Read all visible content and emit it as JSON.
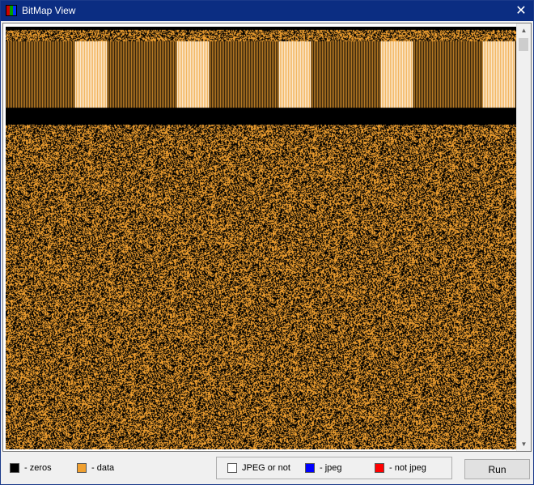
{
  "window": {
    "title": "BitMap View",
    "close_symbol": "✕"
  },
  "bitmap": {
    "colors": {
      "zeros": "#000000",
      "data": "#f0a030",
      "stripe_light": "#ffffff",
      "background": "#ffffff"
    }
  },
  "scrollbar": {
    "up_arrow": "▲",
    "down_arrow": "▼"
  },
  "legend": {
    "zeros": {
      "label": "- zeros",
      "color": "#000000"
    },
    "data": {
      "label": "- data",
      "color": "#f0a030"
    },
    "jpeg_or_not": {
      "label": "JPEG or not",
      "color": "#ffffff"
    },
    "jpeg": {
      "label": "- jpeg",
      "color": "#0000ff"
    },
    "not_jpeg": {
      "label": "- not jpeg",
      "color": "#ff0000"
    }
  },
  "actions": {
    "run_label": "Run"
  }
}
